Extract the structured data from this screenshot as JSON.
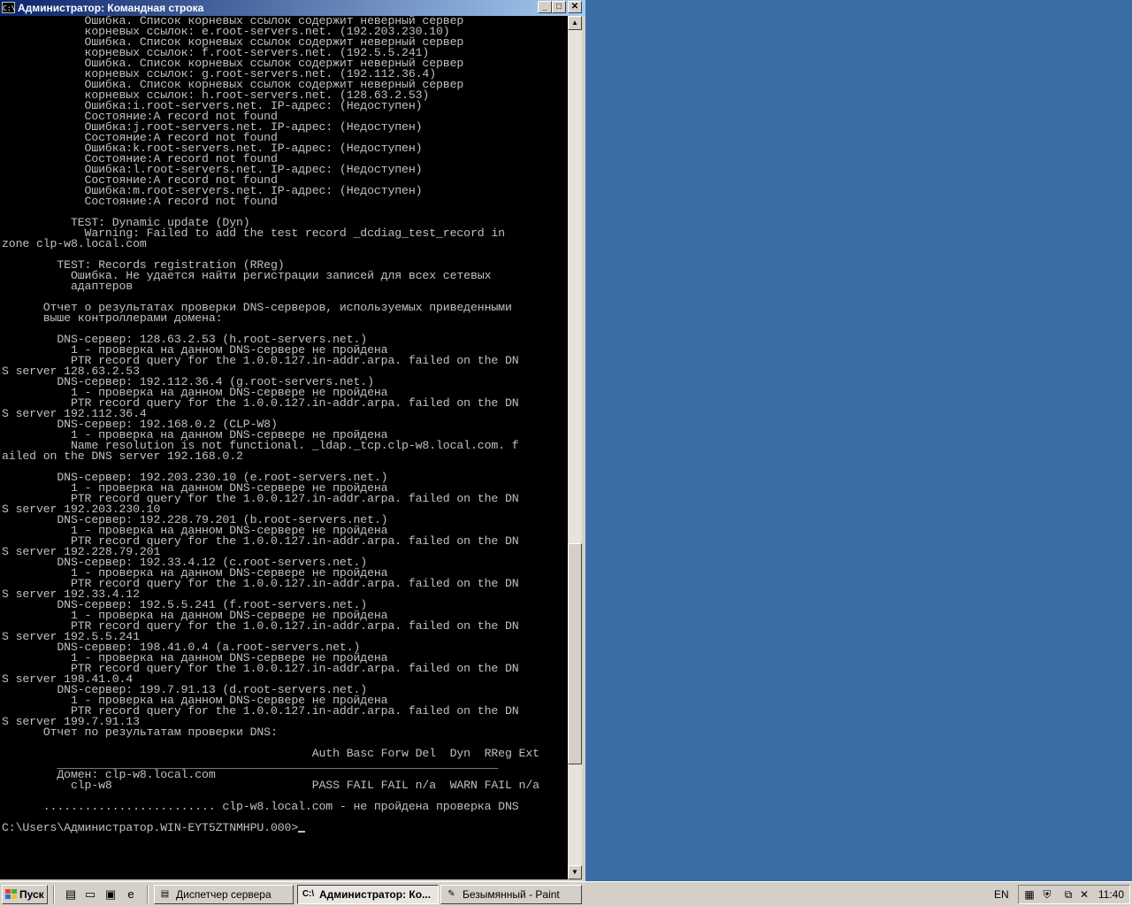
{
  "window": {
    "title": "Администратор: Командная строка",
    "icon_text": "C:\\",
    "controls": {
      "minimize": "_",
      "maximize": "□",
      "close": "✕"
    }
  },
  "console": {
    "lines": [
      "            Ошибка. Список корневых ссылок содержит неверный сервер",
      "            корневых ссылок: e.root-servers.net. (192.203.230.10)",
      "            Ошибка. Список корневых ссылок содержит неверный сервер",
      "            корневых ссылок: f.root-servers.net. (192.5.5.241)",
      "            Ошибка. Список корневых ссылок содержит неверный сервер",
      "            корневых ссылок: g.root-servers.net. (192.112.36.4)",
      "            Ошибка. Список корневых ссылок содержит неверный сервер",
      "            корневых ссылок: h.root-servers.net. (128.63.2.53)",
      "            Ошибка:i.root-servers.net. IP-адрес: (Недоступен)",
      "            Состояние:A record not found",
      "            Ошибка:j.root-servers.net. IP-адрес: (Недоступен)",
      "            Состояние:A record not found",
      "            Ошибка:k.root-servers.net. IP-адрес: (Недоступен)",
      "            Состояние:A record not found",
      "            Ошибка:l.root-servers.net. IP-адрес: (Недоступен)",
      "            Состояние:A record not found",
      "            Ошибка:m.root-servers.net. IP-адрес: (Недоступен)",
      "            Состояние:A record not found",
      "",
      "          TEST: Dynamic update (Dyn)",
      "            Warning: Failed to add the test record _dcdiag_test_record in",
      "zone clp-w8.local.com",
      "",
      "        TEST: Records registration (RReg)",
      "          Ошибка. Не удается найти регистрации записей для всех сетевых",
      "          адаптеров",
      "",
      "      Отчет о результатах проверки DNS-серверов, используемых приведенными",
      "      выше контроллерами домена:",
      "",
      "        DNS-сервер: 128.63.2.53 (h.root-servers.net.)",
      "          1 - проверка на данном DNS-сервере не пройдена",
      "          PTR record query for the 1.0.0.127.in-addr.arpa. failed on the DN",
      "S server 128.63.2.53",
      "        DNS-сервер: 192.112.36.4 (g.root-servers.net.)",
      "          1 - проверка на данном DNS-сервере не пройдена",
      "          PTR record query for the 1.0.0.127.in-addr.arpa. failed on the DN",
      "S server 192.112.36.4",
      "        DNS-сервер: 192.168.0.2 (CLP-W8)",
      "          1 - проверка на данном DNS-сервере не пройдена",
      "          Name resolution is not functional. _ldap._tcp.clp-w8.local.com. f",
      "ailed on the DNS server 192.168.0.2",
      "",
      "        DNS-сервер: 192.203.230.10 (e.root-servers.net.)",
      "          1 - проверка на данном DNS-сервере не пройдена",
      "          PTR record query for the 1.0.0.127.in-addr.arpa. failed on the DN",
      "S server 192.203.230.10",
      "        DNS-сервер: 192.228.79.201 (b.root-servers.net.)",
      "          1 - проверка на данном DNS-сервере не пройдена",
      "          PTR record query for the 1.0.0.127.in-addr.arpa. failed on the DN",
      "S server 192.228.79.201",
      "        DNS-сервер: 192.33.4.12 (c.root-servers.net.)",
      "          1 - проверка на данном DNS-сервере не пройдена",
      "          PTR record query for the 1.0.0.127.in-addr.arpa. failed on the DN",
      "S server 192.33.4.12",
      "        DNS-сервер: 192.5.5.241 (f.root-servers.net.)",
      "          1 - проверка на данном DNS-сервере не пройдена",
      "          PTR record query for the 1.0.0.127.in-addr.arpa. failed on the DN",
      "S server 192.5.5.241",
      "        DNS-сервер: 198.41.0.4 (a.root-servers.net.)",
      "          1 - проверка на данном DNS-сервере не пройдена",
      "          PTR record query for the 1.0.0.127.in-addr.arpa. failed on the DN",
      "S server 198.41.0.4",
      "        DNS-сервер: 199.7.91.13 (d.root-servers.net.)",
      "          1 - проверка на данном DNS-сервере не пройдена",
      "          PTR record query for the 1.0.0.127.in-addr.arpa. failed on the DN",
      "S server 199.7.91.13",
      "      Отчет по результатам проверки DNS:",
      "",
      "                                             Auth Basc Forw Del  Dyn  RReg Ext",
      "        ________________________________________________________________",
      "        Домен: clp-w8.local.com",
      "          clp-w8                             PASS FAIL FAIL n/a  WARN FAIL n/a",
      "",
      "      ......................... clp-w8.local.com - не пройдена проверка DNS",
      "",
      "C:\\Users\\Администратор.WIN-EYT5ZTNMHPU.000>"
    ]
  },
  "taskbar": {
    "start_label": "Пуск",
    "quick_launch": [
      {
        "icon": "server-manager-icon",
        "glyph": "▤"
      },
      {
        "icon": "show-desktop-icon",
        "glyph": "▭"
      },
      {
        "icon": "save-icon",
        "glyph": "▣"
      },
      {
        "icon": "internet-explorer-icon",
        "glyph": "e"
      }
    ],
    "tasks": [
      {
        "label": "Диспетчер сервера",
        "icon": "server-manager-icon",
        "glyph": "▤",
        "active": false
      },
      {
        "label": "Администратор: Ко...",
        "icon": "cmd-icon",
        "glyph": "C:\\",
        "active": true
      },
      {
        "label": "Безымянный - Paint",
        "icon": "paint-icon",
        "glyph": "✎",
        "active": false
      }
    ],
    "language": "EN",
    "tray_icons": [
      {
        "icon": "network-icon",
        "glyph": "▦"
      },
      {
        "icon": "security-shield-icon",
        "glyph": "⛨"
      },
      {
        "icon": "network-connections-icon",
        "glyph": "⧉"
      },
      {
        "icon": "volume-muted-icon",
        "glyph": "✕"
      }
    ],
    "clock": "11:40"
  }
}
